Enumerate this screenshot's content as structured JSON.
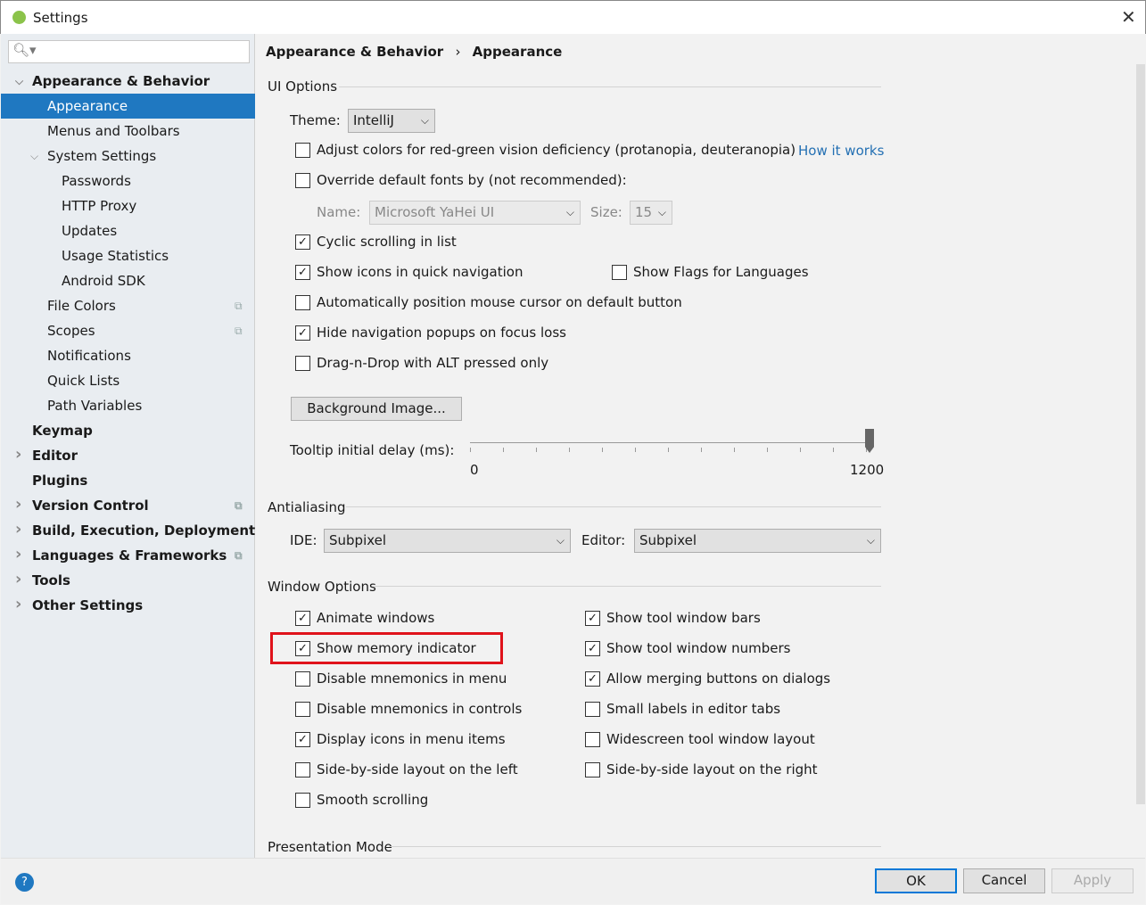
{
  "window": {
    "title": "Settings"
  },
  "sidebar": {
    "search_placeholder": "",
    "items": [
      {
        "label": "Appearance & Behavior",
        "level": 0,
        "expanded": true
      },
      {
        "label": "Appearance",
        "level": 1,
        "selected": true
      },
      {
        "label": "Menus and Toolbars",
        "level": 1
      },
      {
        "label": "System Settings",
        "level": 1,
        "expanded": true
      },
      {
        "label": "Passwords",
        "level": 2
      },
      {
        "label": "HTTP Proxy",
        "level": 2
      },
      {
        "label": "Updates",
        "level": 2
      },
      {
        "label": "Usage Statistics",
        "level": 2
      },
      {
        "label": "Android SDK",
        "level": 2
      },
      {
        "label": "File Colors",
        "level": 1
      },
      {
        "label": "Scopes",
        "level": 1
      },
      {
        "label": "Notifications",
        "level": 1
      },
      {
        "label": "Quick Lists",
        "level": 1
      },
      {
        "label": "Path Variables",
        "level": 1
      },
      {
        "label": "Keymap",
        "level": 0
      },
      {
        "label": "Editor",
        "level": 0
      },
      {
        "label": "Plugins",
        "level": 0
      },
      {
        "label": "Version Control",
        "level": 0
      },
      {
        "label": "Build, Execution, Deployment",
        "level": 0
      },
      {
        "label": "Languages & Frameworks",
        "level": 0
      },
      {
        "label": "Tools",
        "level": 0
      },
      {
        "label": "Other Settings",
        "level": 0
      }
    ]
  },
  "breadcrumb": {
    "parent": "Appearance & Behavior",
    "sep": "›",
    "current": "Appearance"
  },
  "ui_options": {
    "header": "UI Options",
    "theme_label": "Theme:",
    "theme_value": "IntelliJ",
    "adjust_colors": "Adjust colors for red-green vision deficiency (protanopia, deuteranopia)",
    "how_it_works": "How it works",
    "override_fonts": "Override default fonts by (not recommended):",
    "name_label": "Name:",
    "name_value": "Microsoft YaHei UI",
    "size_label": "Size:",
    "size_value": "15",
    "cyclic": "Cyclic scrolling in list",
    "show_icons_nav": "Show icons in quick navigation",
    "show_flags": "Show Flags for Languages",
    "auto_position": "Automatically position mouse cursor on default button",
    "hide_popups": "Hide navigation popups on focus loss",
    "dnd_alt": "Drag-n-Drop with ALT pressed only",
    "background_image": "Background Image...",
    "tooltip_label": "Tooltip initial delay (ms):",
    "tooltip_min": "0",
    "tooltip_max": "1200",
    "tooltip_value": 1200
  },
  "antialiasing": {
    "header": "Antialiasing",
    "ide_label": "IDE:",
    "ide_value": "Subpixel",
    "editor_label": "Editor:",
    "editor_value": "Subpixel"
  },
  "window_options": {
    "header": "Window Options",
    "animate": "Animate windows",
    "memory": "Show memory indicator",
    "dis_mn_menu": "Disable mnemonics in menu",
    "dis_mn_controls": "Disable mnemonics in controls",
    "display_icons": "Display icons in menu items",
    "sbs_left": "Side-by-side layout on the left",
    "smooth": "Smooth scrolling",
    "tool_bars": "Show tool window bars",
    "tool_numbers": "Show tool window numbers",
    "allow_merging": "Allow merging buttons on dialogs",
    "small_labels": "Small labels in editor tabs",
    "widescreen": "Widescreen tool window layout",
    "sbs_right": "Side-by-side layout on the right"
  },
  "presentation": {
    "header": "Presentation Mode"
  },
  "footer": {
    "help": "?",
    "ok": "OK",
    "cancel": "Cancel",
    "apply": "Apply"
  },
  "colors": {
    "accent": "#1f78c1",
    "highlight": "#e0131b",
    "link": "#2470b3"
  }
}
